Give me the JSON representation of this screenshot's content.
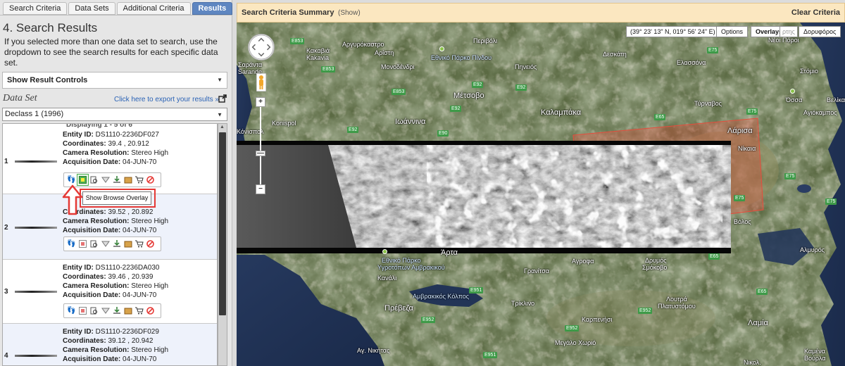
{
  "tabs": [
    {
      "label": "Search Criteria"
    },
    {
      "label": "Data Sets"
    },
    {
      "label": "Additional Criteria"
    },
    {
      "label": "Results"
    }
  ],
  "results": {
    "title": "4. Search Results",
    "description": "If you selected more than one data set to search, use the dropdown to see the search results for each specific data set.",
    "controls_label": "Show Result Controls",
    "dataset_label": "Data Set",
    "export_link": "Click here to export your results »",
    "dataset_selected": "Declass 1 (1996)",
    "displaying": "Displaying 1 - 5 of 6"
  },
  "records": [
    {
      "num": "1",
      "entity_label": "Entity ID:",
      "entity_id": "DS1110-2236DF027",
      "coord_label": "Coordinates:",
      "coords": "39.4 , 20.912",
      "res_label": "Camera Resolution:",
      "resolution": "Stereo High",
      "date_label": "Acquisition Date:",
      "date": "04-JUN-70"
    },
    {
      "num": "2",
      "entity_label": "Entity ID:",
      "entity_id": "DS1110-2236DF028",
      "coord_label": "Coordinates:",
      "coords": "39.52 , 20.892",
      "res_label": "Camera Resolution:",
      "resolution": "Stereo High",
      "date_label": "Acquisition Date:",
      "date": "04-JUN-70"
    },
    {
      "num": "3",
      "entity_label": "Entity ID:",
      "entity_id": "DS1110-2236DA030",
      "coord_label": "Coordinates:",
      "coords": "39.46 , 20.939",
      "res_label": "Camera Resolution:",
      "resolution": "Stereo High",
      "date_label": "Acquisition Date:",
      "date": "04-JUN-70"
    },
    {
      "num": "4",
      "entity_label": "Entity ID:",
      "entity_id": "DS1110-2236DF029",
      "coord_label": "Coordinates:",
      "coords": "39.12 , 20.942",
      "res_label": "Camera Resolution:",
      "resolution": "Stereo High",
      "date_label": "Acquisition Date:",
      "date": "04-JUN-70"
    }
  ],
  "tooltip": "Show Browse Overlay",
  "summary": {
    "title": "Search Criteria Summary",
    "show": "(Show)",
    "clear": "Clear Criteria"
  },
  "map": {
    "coordinates": "(39° 23' 13\" N, 019° 56' 24\" E)",
    "options": "Options",
    "overlays": "Overlays",
    "map_type_partial": "ρτης",
    "satellite": "Δορυφόρος",
    "zoom_in": "+",
    "zoom_out": "−",
    "zoom_handle": "—",
    "places": [
      {
        "label": "Κακαβιά"
      },
      {
        "label": "Kakavia"
      },
      {
        "label": "Σαράντα"
      },
      {
        "label": "Sarande"
      },
      {
        "label": "Αργυρόκαστρο"
      },
      {
        "label": "Αρίστη"
      },
      {
        "label": "Μονοδένδρι"
      },
      {
        "label": "Εθνικό Πάρκο Πίνδου"
      },
      {
        "label": "Περιβόλι"
      },
      {
        "label": "Πηνειός"
      },
      {
        "label": "Δεσκάτη"
      },
      {
        "label": "Ελασσόνα"
      },
      {
        "label": "Νέοι Πόροι"
      },
      {
        "label": "Στόμιο"
      },
      {
        "label": "Όσσα"
      },
      {
        "label": "Βελίκα"
      },
      {
        "label": "Αγιόκαμπος"
      },
      {
        "label": "Μέτσοβο"
      },
      {
        "label": "Καλαμπάκα"
      },
      {
        "label": "Τύρναβος"
      },
      {
        "label": "Ιωάννινα"
      },
      {
        "label": "Konispol"
      },
      {
        "label": "Κόνισπολ"
      },
      {
        "label": "Λάρισα"
      },
      {
        "label": "Νίκαια"
      },
      {
        "label": "Βόλος"
      },
      {
        "label": "Άρτα"
      },
      {
        "label": "Αγροφα"
      },
      {
        "label": "Εθνικό Πάρκο"
      },
      {
        "label": "Υγροτόπων Αμβρακικού"
      },
      {
        "label": "Κανάλι"
      },
      {
        "label": "Γρανίτσα"
      },
      {
        "label": "Δρυμός"
      },
      {
        "label": "Σμόκοβο"
      },
      {
        "label": "Αλμυρός"
      },
      {
        "label": "Αμβρακικός Κόλπος"
      },
      {
        "label": "Πρέβεζα"
      },
      {
        "label": "Τρίκλινο"
      },
      {
        "label": "Λουτρά"
      },
      {
        "label": "Πλατυστόμου"
      },
      {
        "label": "Καρπενήσι"
      },
      {
        "label": "Λαμία"
      },
      {
        "label": "Μεγάλο Χωριό"
      },
      {
        "label": "Αγ. Νικήτας"
      },
      {
        "label": "Καμένα"
      },
      {
        "label": "Βούρλα"
      },
      {
        "label": "Νικολ."
      }
    ],
    "roads": [
      "E853",
      "E853",
      "E92",
      "E853",
      "E92",
      "E92",
      "E90",
      "E92",
      "E75",
      "E75",
      "E75",
      "E75",
      "E65",
      "E65",
      "E951",
      "E952",
      "E952",
      "E952",
      "E951",
      "E65",
      "E75"
    ]
  }
}
